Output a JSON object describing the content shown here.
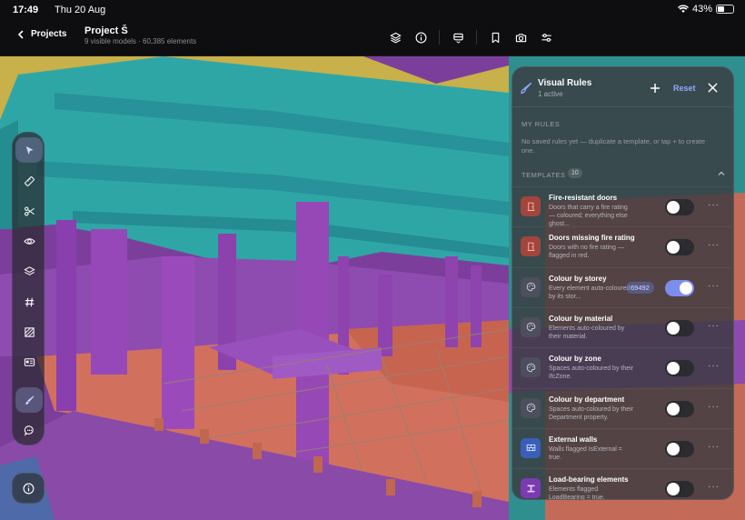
{
  "status_bar": {
    "time": "17:49",
    "date": "Thu 20 Aug",
    "battery": "43%"
  },
  "topbar": {
    "back_label": "Projects",
    "project_title": "Project Š",
    "project_subtitle": "9 visible models · 60,385 elements",
    "tools": [
      "layers-icon",
      "info-icon",
      "section-box-icon",
      "bookmark-icon",
      "camera-icon",
      "sliders-icon"
    ]
  },
  "rail": {
    "tools": [
      "select-icon",
      "measure-icon",
      "cut-icon",
      "visibility-icon",
      "layers-icon",
      "grid-icon",
      "hatch-icon",
      "id-card-icon",
      "brush-icon",
      "chat-icon"
    ],
    "active": "brush-icon"
  },
  "panel": {
    "title": "Visual Rules",
    "subtitle": "1 active",
    "reset_label": "Reset",
    "my_rules_label": "MY RULES",
    "empty_note": "No saved rules yet — duplicate a template, or tap + to create one.",
    "templates_label": "TEMPLATES",
    "templates_count": "10",
    "rules": [
      {
        "name": "Fire-resistant doors",
        "desc": "Doors that carry a fire rating — coloured; everything else ghost...",
        "icon": "door-icon",
        "icon_bg": "#a2453c",
        "enabled": false,
        "count": ""
      },
      {
        "name": "Doors missing fire rating",
        "desc": "Doors with no fire rating — flagged in red.",
        "icon": "door-icon",
        "icon_bg": "#a2453c",
        "enabled": false,
        "count": ""
      },
      {
        "name": "Colour by storey",
        "desc": "Every element auto-coloured by its stor...",
        "icon": "palette-icon",
        "icon_bg": "#4d4f5c",
        "enabled": true,
        "count": "69492"
      },
      {
        "name": "Colour by material",
        "desc": "Elements auto-coloured by their material.",
        "icon": "palette-icon",
        "icon_bg": "#4d4f5c",
        "enabled": false,
        "count": ""
      },
      {
        "name": "Colour by zone",
        "desc": "Spaces auto-coloured by their IfcZone.",
        "icon": "palette-icon",
        "icon_bg": "#4d4f5c",
        "enabled": false,
        "count": ""
      },
      {
        "name": "Colour by department",
        "desc": "Spaces auto-coloured by their Department property.",
        "icon": "palette-icon",
        "icon_bg": "#4d4f5c",
        "enabled": false,
        "count": ""
      },
      {
        "name": "External walls",
        "desc": "Walls flagged IsExternal = true.",
        "icon": "wall-icon",
        "icon_bg": "#3a5fb8",
        "enabled": false,
        "count": ""
      },
      {
        "name": "Load-bearing elements",
        "desc": "Elements flagged LoadBearing = true.",
        "icon": "beam-icon",
        "icon_bg": "#7a3bb0",
        "enabled": false,
        "count": ""
      }
    ]
  },
  "colors": {
    "accent": "#8fa9ff",
    "toggle_on": "#7c8eed"
  }
}
